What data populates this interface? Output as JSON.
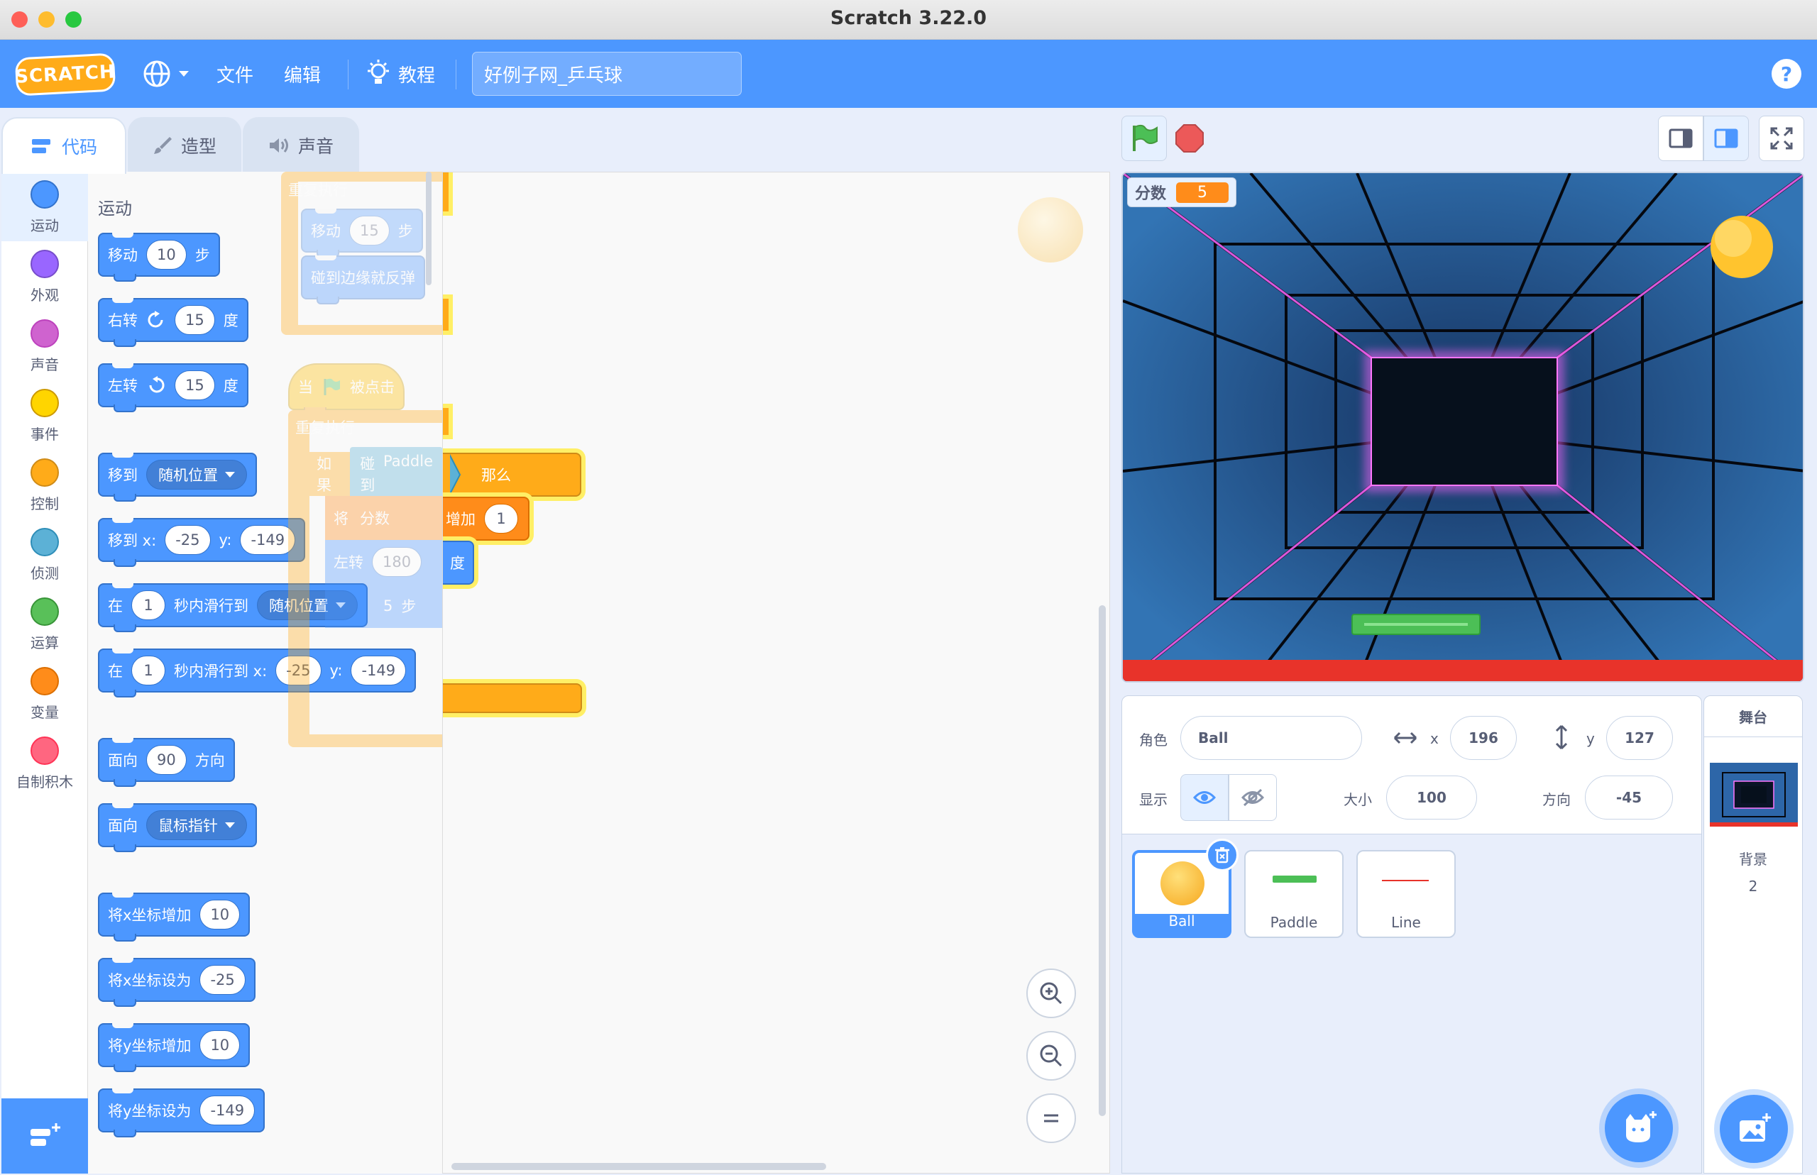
{
  "window": {
    "title": "Scratch 3.22.0"
  },
  "menu": {
    "logo": "SCRATCH",
    "file": "文件",
    "edit": "编辑",
    "tutorials": "教程",
    "project_title": "好例子网_乒乓球",
    "help": "?"
  },
  "tabs": {
    "code": "代码",
    "costumes": "造型",
    "sounds": "声音"
  },
  "categories": [
    {
      "label": "运动",
      "color": "#4c97ff"
    },
    {
      "label": "外观",
      "color": "#9966ff"
    },
    {
      "label": "声音",
      "color": "#cf63cf"
    },
    {
      "label": "事件",
      "color": "#ffd500"
    },
    {
      "label": "控制",
      "color": "#ffab19"
    },
    {
      "label": "侦测",
      "color": "#5cb1d6"
    },
    {
      "label": "运算",
      "color": "#59c059"
    },
    {
      "label": "变量",
      "color": "#ff8c1a"
    },
    {
      "label": "自制积木",
      "color": "#ff6680"
    }
  ],
  "palette": {
    "heading": "运动",
    "move": {
      "a": "移动",
      "v": "10",
      "b": "步"
    },
    "turn_right": {
      "a": "右转",
      "v": "15",
      "b": "度"
    },
    "turn_left": {
      "a": "左转",
      "v": "15",
      "b": "度"
    },
    "goto": {
      "a": "移到",
      "opt": "随机位置"
    },
    "goto_xy": {
      "a": "移到 x:",
      "x": "-25",
      "b": "y:",
      "y": "-149"
    },
    "glide": {
      "a": "在",
      "v": "1",
      "b": "秒内滑行到",
      "opt": "随机位置"
    },
    "glide_xy": {
      "a": "在",
      "v": "1",
      "b": "秒内滑行到 x:",
      "x": "-25",
      "c": "y:",
      "y": "-149"
    },
    "point_dir": {
      "a": "面向",
      "v": "90",
      "b": "方向"
    },
    "point_towards": {
      "a": "面向",
      "opt": "鼠标指针"
    },
    "change_x": {
      "a": "将x坐标增加",
      "v": "10"
    },
    "set_x": {
      "a": "将x坐标设为",
      "v": "-25"
    },
    "change_y": {
      "a": "将y坐标增加",
      "v": "10"
    },
    "set_y": {
      "a": "将y坐标设为",
      "v": "-149"
    }
  },
  "scripts": {
    "forever1": "重复执行",
    "move15": {
      "a": "移动",
      "v": "15",
      "b": "步"
    },
    "bounce": "碰到边缘就反弹",
    "flag_hat": {
      "a": "当",
      "b": "被点击"
    },
    "forever2": "重复执行",
    "if": {
      "a": "如果",
      "touch": "碰到",
      "target": "Paddle",
      "q": "?",
      "then": "那么"
    },
    "change_var": {
      "a": "将",
      "var": "分数",
      "b": "增加",
      "v": "1"
    },
    "turn180": {
      "a": "左转",
      "v": "180",
      "b": "度"
    },
    "move5": {
      "v": "5",
      "b": "步"
    }
  },
  "stage": {
    "monitor_label": "分数",
    "monitor_value": "5"
  },
  "sprite_info": {
    "sprite_label": "角色",
    "sprite_name": "Ball",
    "x_label": "x",
    "x": "196",
    "y_label": "y",
    "y": "127",
    "show_label": "显示",
    "size_label": "大小",
    "size": "100",
    "direction_label": "方向",
    "direction": "-45"
  },
  "sprites": [
    {
      "name": "Ball"
    },
    {
      "name": "Paddle"
    },
    {
      "name": "Line"
    }
  ],
  "stage_panel": {
    "title": "舞台",
    "backdrop_label": "背景",
    "backdrop_count": "2"
  }
}
